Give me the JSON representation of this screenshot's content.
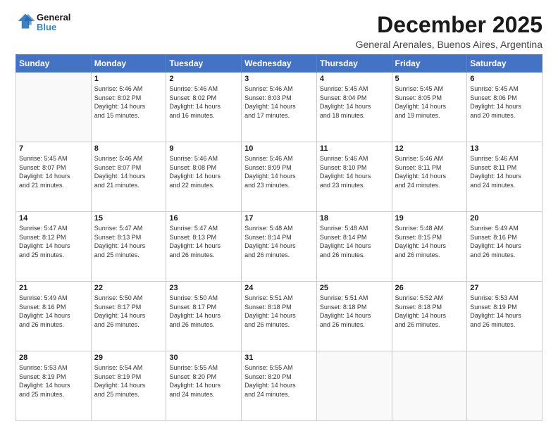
{
  "logo": {
    "line1": "General",
    "line2": "Blue"
  },
  "title": "December 2025",
  "subtitle": "General Arenales, Buenos Aires, Argentina",
  "weekdays": [
    "Sunday",
    "Monday",
    "Tuesday",
    "Wednesday",
    "Thursday",
    "Friday",
    "Saturday"
  ],
  "weeks": [
    [
      {
        "day": "",
        "info": ""
      },
      {
        "day": "1",
        "info": "Sunrise: 5:46 AM\nSunset: 8:02 PM\nDaylight: 14 hours\nand 15 minutes."
      },
      {
        "day": "2",
        "info": "Sunrise: 5:46 AM\nSunset: 8:02 PM\nDaylight: 14 hours\nand 16 minutes."
      },
      {
        "day": "3",
        "info": "Sunrise: 5:46 AM\nSunset: 8:03 PM\nDaylight: 14 hours\nand 17 minutes."
      },
      {
        "day": "4",
        "info": "Sunrise: 5:45 AM\nSunset: 8:04 PM\nDaylight: 14 hours\nand 18 minutes."
      },
      {
        "day": "5",
        "info": "Sunrise: 5:45 AM\nSunset: 8:05 PM\nDaylight: 14 hours\nand 19 minutes."
      },
      {
        "day": "6",
        "info": "Sunrise: 5:45 AM\nSunset: 8:06 PM\nDaylight: 14 hours\nand 20 minutes."
      }
    ],
    [
      {
        "day": "7",
        "info": "Sunrise: 5:45 AM\nSunset: 8:07 PM\nDaylight: 14 hours\nand 21 minutes."
      },
      {
        "day": "8",
        "info": "Sunrise: 5:46 AM\nSunset: 8:07 PM\nDaylight: 14 hours\nand 21 minutes."
      },
      {
        "day": "9",
        "info": "Sunrise: 5:46 AM\nSunset: 8:08 PM\nDaylight: 14 hours\nand 22 minutes."
      },
      {
        "day": "10",
        "info": "Sunrise: 5:46 AM\nSunset: 8:09 PM\nDaylight: 14 hours\nand 23 minutes."
      },
      {
        "day": "11",
        "info": "Sunrise: 5:46 AM\nSunset: 8:10 PM\nDaylight: 14 hours\nand 23 minutes."
      },
      {
        "day": "12",
        "info": "Sunrise: 5:46 AM\nSunset: 8:11 PM\nDaylight: 14 hours\nand 24 minutes."
      },
      {
        "day": "13",
        "info": "Sunrise: 5:46 AM\nSunset: 8:11 PM\nDaylight: 14 hours\nand 24 minutes."
      }
    ],
    [
      {
        "day": "14",
        "info": "Sunrise: 5:47 AM\nSunset: 8:12 PM\nDaylight: 14 hours\nand 25 minutes."
      },
      {
        "day": "15",
        "info": "Sunrise: 5:47 AM\nSunset: 8:13 PM\nDaylight: 14 hours\nand 25 minutes."
      },
      {
        "day": "16",
        "info": "Sunrise: 5:47 AM\nSunset: 8:13 PM\nDaylight: 14 hours\nand 26 minutes."
      },
      {
        "day": "17",
        "info": "Sunrise: 5:48 AM\nSunset: 8:14 PM\nDaylight: 14 hours\nand 26 minutes."
      },
      {
        "day": "18",
        "info": "Sunrise: 5:48 AM\nSunset: 8:14 PM\nDaylight: 14 hours\nand 26 minutes."
      },
      {
        "day": "19",
        "info": "Sunrise: 5:48 AM\nSunset: 8:15 PM\nDaylight: 14 hours\nand 26 minutes."
      },
      {
        "day": "20",
        "info": "Sunrise: 5:49 AM\nSunset: 8:16 PM\nDaylight: 14 hours\nand 26 minutes."
      }
    ],
    [
      {
        "day": "21",
        "info": "Sunrise: 5:49 AM\nSunset: 8:16 PM\nDaylight: 14 hours\nand 26 minutes."
      },
      {
        "day": "22",
        "info": "Sunrise: 5:50 AM\nSunset: 8:17 PM\nDaylight: 14 hours\nand 26 minutes."
      },
      {
        "day": "23",
        "info": "Sunrise: 5:50 AM\nSunset: 8:17 PM\nDaylight: 14 hours\nand 26 minutes."
      },
      {
        "day": "24",
        "info": "Sunrise: 5:51 AM\nSunset: 8:18 PM\nDaylight: 14 hours\nand 26 minutes."
      },
      {
        "day": "25",
        "info": "Sunrise: 5:51 AM\nSunset: 8:18 PM\nDaylight: 14 hours\nand 26 minutes."
      },
      {
        "day": "26",
        "info": "Sunrise: 5:52 AM\nSunset: 8:18 PM\nDaylight: 14 hours\nand 26 minutes."
      },
      {
        "day": "27",
        "info": "Sunrise: 5:53 AM\nSunset: 8:19 PM\nDaylight: 14 hours\nand 26 minutes."
      }
    ],
    [
      {
        "day": "28",
        "info": "Sunrise: 5:53 AM\nSunset: 8:19 PM\nDaylight: 14 hours\nand 25 minutes."
      },
      {
        "day": "29",
        "info": "Sunrise: 5:54 AM\nSunset: 8:19 PM\nDaylight: 14 hours\nand 25 minutes."
      },
      {
        "day": "30",
        "info": "Sunrise: 5:55 AM\nSunset: 8:20 PM\nDaylight: 14 hours\nand 24 minutes."
      },
      {
        "day": "31",
        "info": "Sunrise: 5:55 AM\nSunset: 8:20 PM\nDaylight: 14 hours\nand 24 minutes."
      },
      {
        "day": "",
        "info": ""
      },
      {
        "day": "",
        "info": ""
      },
      {
        "day": "",
        "info": ""
      }
    ]
  ]
}
